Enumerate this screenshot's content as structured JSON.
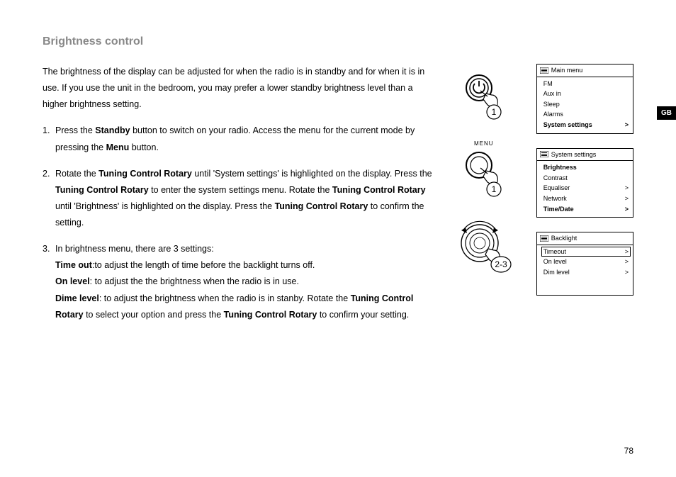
{
  "heading": "Brightness control",
  "intro": "The brightness of the display can be adjusted for when the radio is in standby  and for when it is in use. If you use the unit in the bedroom, you may prefer a lower standby brightness level than a higher brightness setting.",
  "step1": {
    "num": "1.",
    "t1": "Press the ",
    "b1": "Standby",
    "t2": " button to switch on your radio. Access the menu for the current mode by pressing the ",
    "b2": "Menu",
    "t3": " button."
  },
  "step2": {
    "num": "2.",
    "t1": "Rotate the ",
    "b1": "Tuning Control Rotary",
    "t2": " until 'System settings' is highlighted on the display. Press the ",
    "b2": "Tuning Control Rotary",
    "t3": " to enter the system settings menu. Rotate the ",
    "b3": "Tuning Control Rotary",
    "t4": " until 'Brightness' is highlighted on the display. Press the ",
    "b4": "Tuning Control Rotary",
    "t5": " to confirm the setting."
  },
  "step3": {
    "num": "3.",
    "t1": "In brightness menu, there are 3 settings:",
    "b1": "Time out",
    "t2": ":to adjust the length of time before the backlight turns off.",
    "b2": "On level",
    "t3": ": to adjust the the brightness when the radio is in use.",
    "b3": "Dime level",
    "t4": ": to adjust the brightness when the radio is in stanby. Rotate the ",
    "b4": "Tuning Control Rotary",
    "t5": " to select your option and press the ",
    "b5": "Tuning Control Rotary",
    "t6": " to confirm your setting."
  },
  "fig": {
    "badge1": "1",
    "menu_label": "MENU",
    "badge2": "1",
    "badge3": "2-3"
  },
  "menus": {
    "m1": {
      "title": "Main menu",
      "items": [
        {
          "label": "FM",
          "arrow": "",
          "bold": false,
          "hl": false
        },
        {
          "label": "Aux in",
          "arrow": "",
          "bold": false,
          "hl": false
        },
        {
          "label": "Sleep",
          "arrow": "",
          "bold": false,
          "hl": false
        },
        {
          "label": "Alarms",
          "arrow": "",
          "bold": false,
          "hl": false
        },
        {
          "label": "System settings",
          "arrow": ">",
          "bold": true,
          "hl": false
        }
      ]
    },
    "m2": {
      "title": "System settings",
      "items": [
        {
          "label": "Brightness",
          "arrow": "",
          "bold": true,
          "hl": false
        },
        {
          "label": "Contrast",
          "arrow": "",
          "bold": false,
          "hl": false
        },
        {
          "label": "Equaliser",
          "arrow": ">",
          "bold": false,
          "hl": false
        },
        {
          "label": "Network",
          "arrow": ">",
          "bold": false,
          "hl": false
        },
        {
          "label": "Time/Date",
          "arrow": ">",
          "bold": true,
          "hl": false
        }
      ]
    },
    "m3": {
      "title": "Backlight",
      "items": [
        {
          "label": "Timeout",
          "arrow": ">",
          "bold": false,
          "hl": true
        },
        {
          "label": "On level",
          "arrow": ">",
          "bold": false,
          "hl": false
        },
        {
          "label": "Dim level",
          "arrow": ">",
          "bold": false,
          "hl": false
        }
      ]
    }
  },
  "tab": "GB",
  "page_number": "78"
}
